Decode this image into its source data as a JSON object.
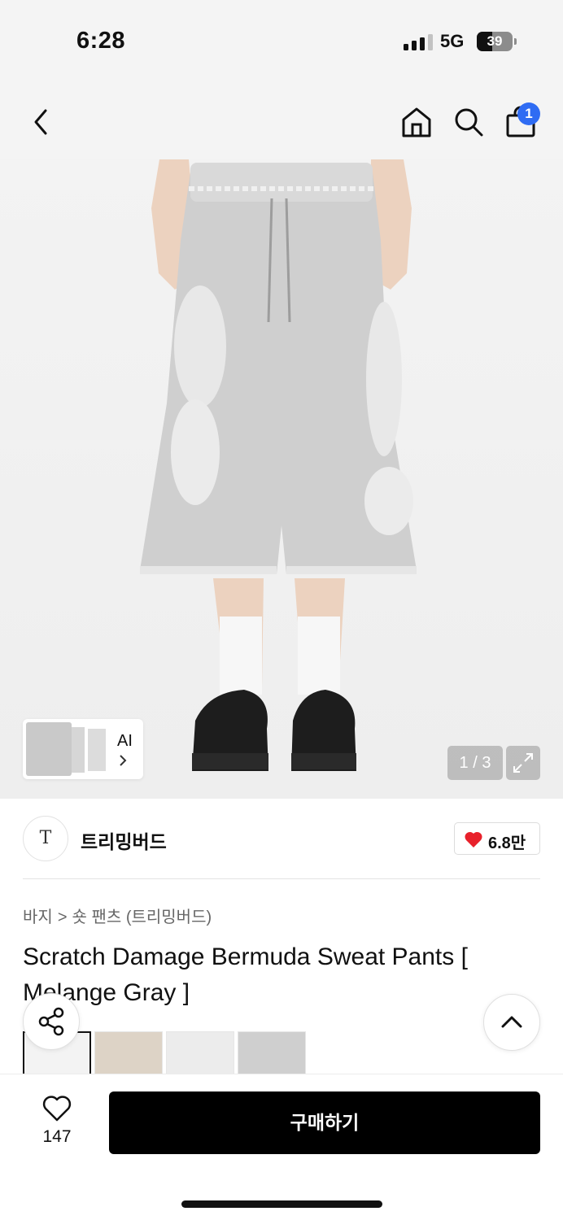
{
  "status_bar": {
    "time": "6:28",
    "network": "5G",
    "battery": "39",
    "signal_bars_active": 3
  },
  "nav": {
    "back_icon": "chevron-left-icon",
    "home_icon": "home-icon",
    "search_icon": "search-icon",
    "cart_icon": "shopping-bag-icon",
    "cart_badge": "1"
  },
  "gallery": {
    "ai_label": "AI",
    "counter": "1 / 3",
    "expand_icon": "expand-icon"
  },
  "brand": {
    "logo_text": "T",
    "name": "트리밍버드",
    "likes": "6.8만",
    "heart_color": "#e8212b"
  },
  "product": {
    "breadcrumb": [
      "바지",
      "숏 팬츠 (트리밍버드)"
    ],
    "title": "Scratch Damage Bermuda Sweat Pants [ Melange Gray ]"
  },
  "bottom_bar": {
    "wish_count": "147",
    "buy_label": "구매하기"
  },
  "colors": {
    "accent_blue": "#2f6cf3",
    "buy_button": "#000000"
  }
}
